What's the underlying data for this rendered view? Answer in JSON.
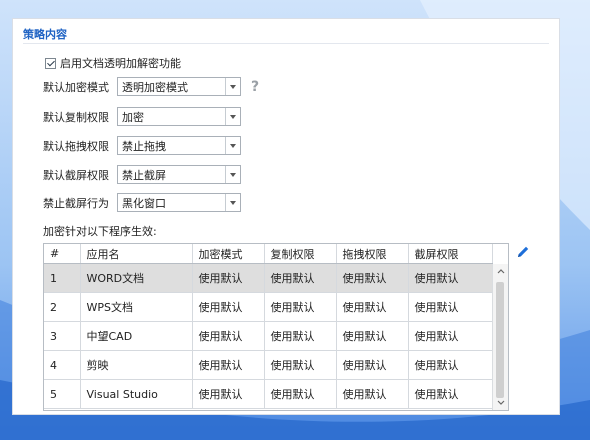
{
  "section": {
    "title": "策略内容"
  },
  "enable_feature": {
    "label": "启用文档透明加解密功能",
    "checked": true
  },
  "fields": [
    {
      "label": "默认加密模式",
      "value": "透明加密模式"
    },
    {
      "label": "默认复制权限",
      "value": "加密"
    },
    {
      "label": "默认拖拽权限",
      "value": "禁止拖拽"
    },
    {
      "label": "默认截屏权限",
      "value": "禁止截屏"
    },
    {
      "label": "禁止截屏行为",
      "value": "黑化窗口"
    }
  ],
  "help_icon": "question-mark-icon",
  "table": {
    "caption": "加密针对以下程序生效:",
    "columns": [
      "#",
      "应用名",
      "加密模式",
      "复制权限",
      "拖拽权限",
      "截屏权限"
    ],
    "rows": [
      [
        "1",
        "WORD文档",
        "使用默认",
        "使用默认",
        "使用默认",
        "使用默认"
      ],
      [
        "2",
        "WPS文档",
        "使用默认",
        "使用默认",
        "使用默认",
        "使用默认"
      ],
      [
        "3",
        "中望CAD",
        "使用默认",
        "使用默认",
        "使用默认",
        "使用默认"
      ],
      [
        "4",
        "剪映",
        "使用默认",
        "使用默认",
        "使用默认",
        "使用默认"
      ],
      [
        "5",
        "Visual Studio",
        "使用默认",
        "使用默认",
        "使用默认",
        "使用默认"
      ]
    ],
    "selected_row": 0
  },
  "edit_icon": "pencil-icon",
  "colors": {
    "accent": "#1f63c4",
    "selected_row": "#dedede",
    "edit_icon": "#1e6fd9"
  }
}
